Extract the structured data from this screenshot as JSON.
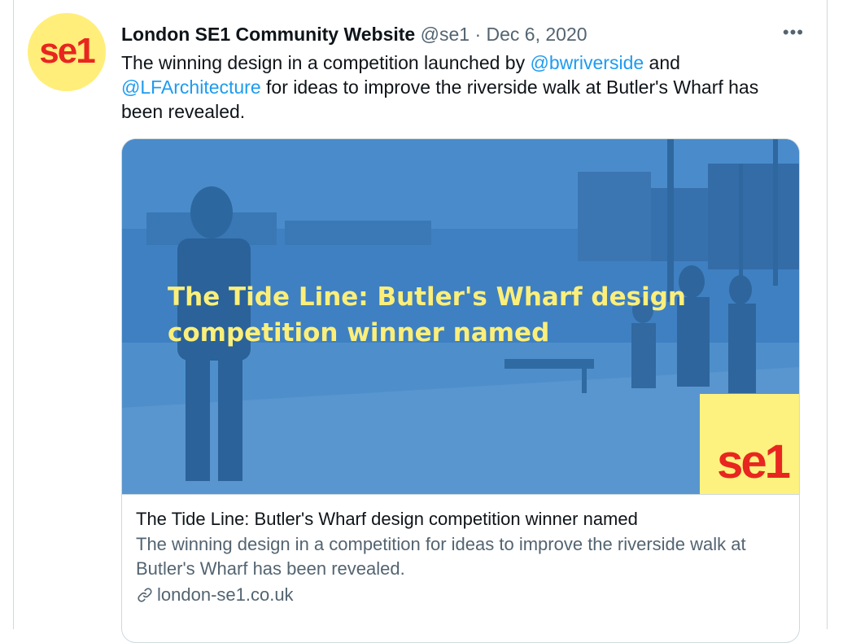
{
  "tweet": {
    "author_name": "London SE1 Community Website",
    "handle": "@se1",
    "separator": "·",
    "date": "Dec 6, 2020",
    "more_icon": "more-horizontal-icon",
    "avatar_text": "se1",
    "text_part1": "The winning design in a competition launched by ",
    "mention1": "@bwriverside",
    "text_part2": " and ",
    "mention2": "@LFArchitecture",
    "text_part3": " for ideas to improve the riverside walk at Butler's Wharf has been revealed."
  },
  "card": {
    "image_headline": "The Tide Line: Butler's Wharf design competition winner named",
    "logo_text": "se1",
    "title": "The Tide Line: Butler's Wharf design competition winner named",
    "description": "The winning design in a competition for ideas to improve the riverside walk at Butler's Wharf has been revealed.",
    "domain": "london-se1.co.uk",
    "link_icon": "link-icon"
  },
  "colors": {
    "accent": "#1d9bf0",
    "image_overlay": "#3a7cbf",
    "headline_yellow": "#fbef7a",
    "logo_red": "#e8261f",
    "logo_yellow": "#fdf27f"
  }
}
